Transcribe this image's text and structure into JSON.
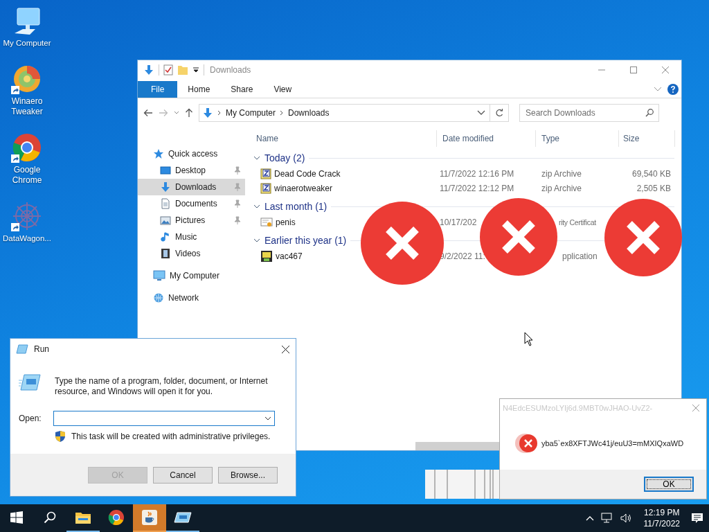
{
  "desktop_icons": [
    {
      "label": "My Computer",
      "kind": "computer",
      "shortcut": false
    },
    {
      "label": "Winaero Tweaker",
      "kind": "winaero",
      "shortcut": true
    },
    {
      "label": "Google Chrome",
      "kind": "chrome",
      "shortcut": true
    },
    {
      "label": "DataWagon...",
      "kind": "datawagon",
      "shortcut": true
    }
  ],
  "explorer": {
    "title": "Downloads",
    "ribbon_tabs": [
      {
        "label": "File",
        "kind": "file"
      },
      {
        "label": "Home",
        "kind": "tab"
      },
      {
        "label": "Share",
        "kind": "tab"
      },
      {
        "label": "View",
        "kind": "tab"
      }
    ],
    "breadcrumb": [
      "My Computer",
      "Downloads"
    ],
    "search": {
      "placeholder": "Search Downloads"
    },
    "sidebar": [
      {
        "label": "Quick access",
        "kind": "star",
        "selected": false,
        "children": [
          {
            "label": "Desktop",
            "kind": "desktop",
            "pinned": true,
            "selected": false
          },
          {
            "label": "Downloads",
            "kind": "downloads",
            "pinned": true,
            "selected": true
          },
          {
            "label": "Documents",
            "kind": "documents",
            "pinned": true,
            "selected": false
          },
          {
            "label": "Pictures",
            "kind": "pictures",
            "pinned": true,
            "selected": false
          },
          {
            "label": "Music",
            "kind": "music",
            "pinned": false,
            "selected": false
          },
          {
            "label": "Videos",
            "kind": "videos",
            "pinned": false,
            "selected": false
          }
        ]
      },
      {
        "label": "My Computer",
        "kind": "computer",
        "selected": false
      },
      {
        "label": "Network",
        "kind": "network",
        "selected": false
      }
    ],
    "columns": [
      "Name",
      "Date modified",
      "Type",
      "Size"
    ],
    "groups": [
      {
        "title": "Today (2)",
        "expanded": true,
        "rows": [
          {
            "name": "Dead Code Crack",
            "kind": "zip",
            "date": "11/7/2022 12:16 PM",
            "type": "zip Archive",
            "size": "69,540 KB"
          },
          {
            "name": "winaerotweaker",
            "kind": "zip",
            "date": "11/7/2022 12:12 PM",
            "type": "zip Archive",
            "size": "2,505 KB"
          }
        ]
      },
      {
        "title": "Last month (1)",
        "expanded": true,
        "rows": [
          {
            "name": "penis",
            "kind": "certificate",
            "date": "10/17/202",
            "type": "rity Certificat"
          }
        ]
      },
      {
        "title": "Earlier this year (1)",
        "expanded": true,
        "rows": [
          {
            "name": "vac467",
            "kind": "application",
            "date": "9/2/2022 11:",
            "type": "pplication"
          }
        ]
      }
    ]
  },
  "run_dialog": {
    "title": "Run",
    "message": "Type the name of a program, folder, document, or Internet resource, and Windows will open it for you.",
    "open_label": "Open:",
    "admin_note": "This task will be created with administrative privileges.",
    "buttons": [
      {
        "label": "OK",
        "disabled": true
      },
      {
        "label": "Cancel",
        "disabled": false
      },
      {
        "label": "Browse...",
        "disabled": false
      }
    ]
  },
  "error_dialog": {
    "title": "N4EdcESUMzoLYIj6d.9MBT0wJHAO-UvZ2-",
    "message": "yba5`ex8XFTJWc41j/euU3=mMXIQxaWD",
    "button": "OK"
  },
  "taskbar": {
    "items": [
      {
        "kind": "start",
        "running": false,
        "selected": false
      },
      {
        "kind": "search",
        "running": false,
        "selected": false
      },
      {
        "kind": "explorer",
        "running": true,
        "selected": false
      },
      {
        "kind": "chrome",
        "running": false,
        "selected": false
      },
      {
        "kind": "java",
        "running": false,
        "selected": true
      },
      {
        "kind": "run",
        "running": true,
        "selected": false
      }
    ],
    "time": "12:19 PM",
    "date": "11/7/2022"
  }
}
